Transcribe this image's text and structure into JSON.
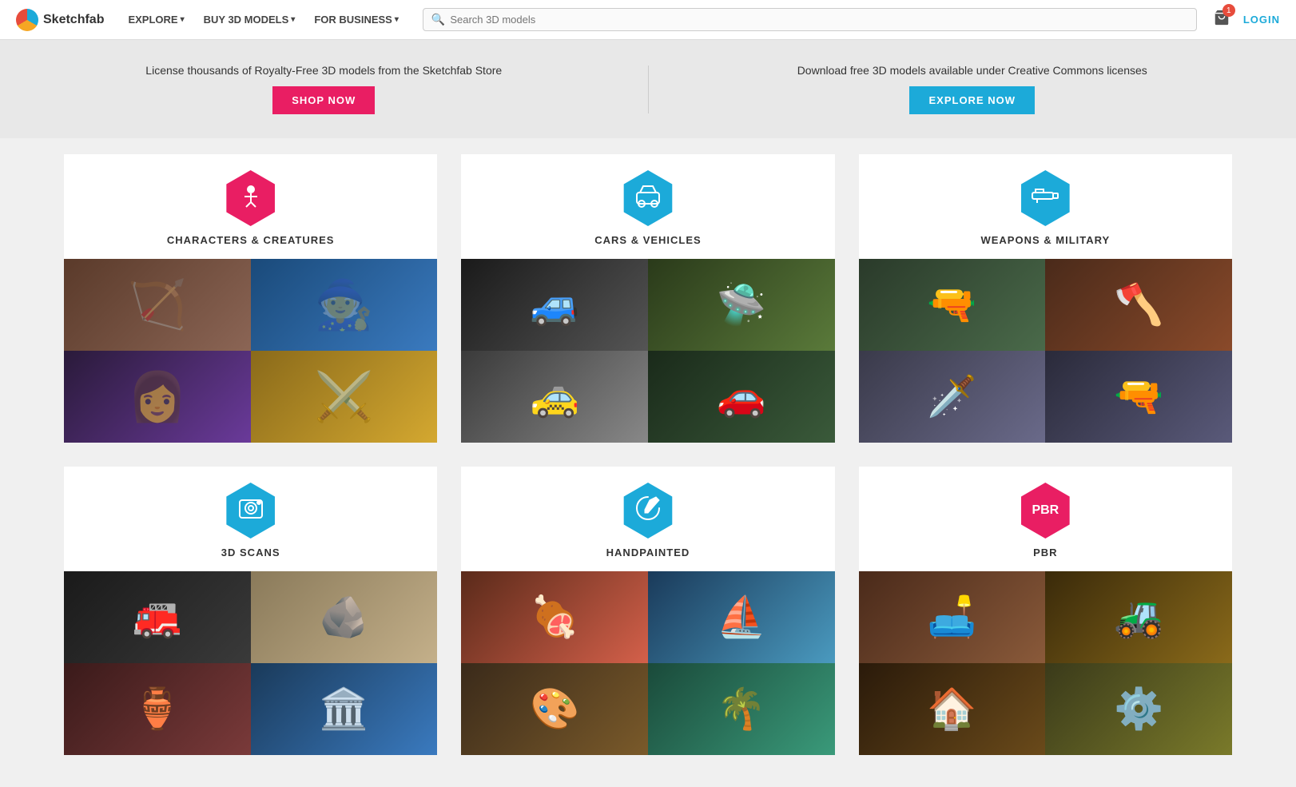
{
  "nav": {
    "brand": "Sketchfab",
    "links": [
      {
        "label": "EXPLORE",
        "hasDropdown": true
      },
      {
        "label": "BUY 3D MODELS",
        "hasDropdown": true
      },
      {
        "label": "FOR BUSINESS",
        "hasDropdown": true
      }
    ],
    "search_placeholder": "Search 3D models",
    "cart_count": "1",
    "login_label": "LOGIN"
  },
  "banner": {
    "left_text": "License thousands of Royalty-Free 3D models from the Sketchfab Store",
    "left_btn": "SHOP NOW",
    "right_text": "Download free 3D models available under Creative Commons licenses",
    "right_btn": "EXPLORE NOW"
  },
  "categories": [
    {
      "id": "characters",
      "title": "CHARACTERS & CREATURES",
      "icon_color": "pink",
      "icon_symbol": "🧍",
      "images": [
        "img-c1",
        "img-c2",
        "img-c3",
        "img-c4"
      ]
    },
    {
      "id": "cars",
      "title": "CARS & VEHICLES",
      "icon_color": "blue",
      "icon_symbol": "🚗",
      "images": [
        "img-v1",
        "img-v2",
        "img-v3",
        "img-v4"
      ]
    },
    {
      "id": "weapons",
      "title": "WEAPONS & MILITARY",
      "icon_color": "blue",
      "icon_symbol": "🔫",
      "images": [
        "img-w1",
        "img-w2",
        "img-w3",
        "img-w4"
      ]
    },
    {
      "id": "scans",
      "title": "3D SCANS",
      "icon_color": "blue",
      "icon_symbol": "📷",
      "images": [
        "img-s1",
        "img-s2",
        "img-s3",
        "img-s4"
      ]
    },
    {
      "id": "handpainted",
      "title": "HANDPAINTED",
      "icon_color": "blue",
      "icon_symbol": "🎨",
      "images": [
        "img-h1",
        "img-h2",
        "img-h3",
        "img-h4"
      ]
    },
    {
      "id": "pbr",
      "title": "PBR",
      "icon_color": "pink",
      "icon_symbol": "⬡",
      "images": [
        "img-p1",
        "img-p2",
        "img-p3",
        "img-p4"
      ]
    }
  ]
}
